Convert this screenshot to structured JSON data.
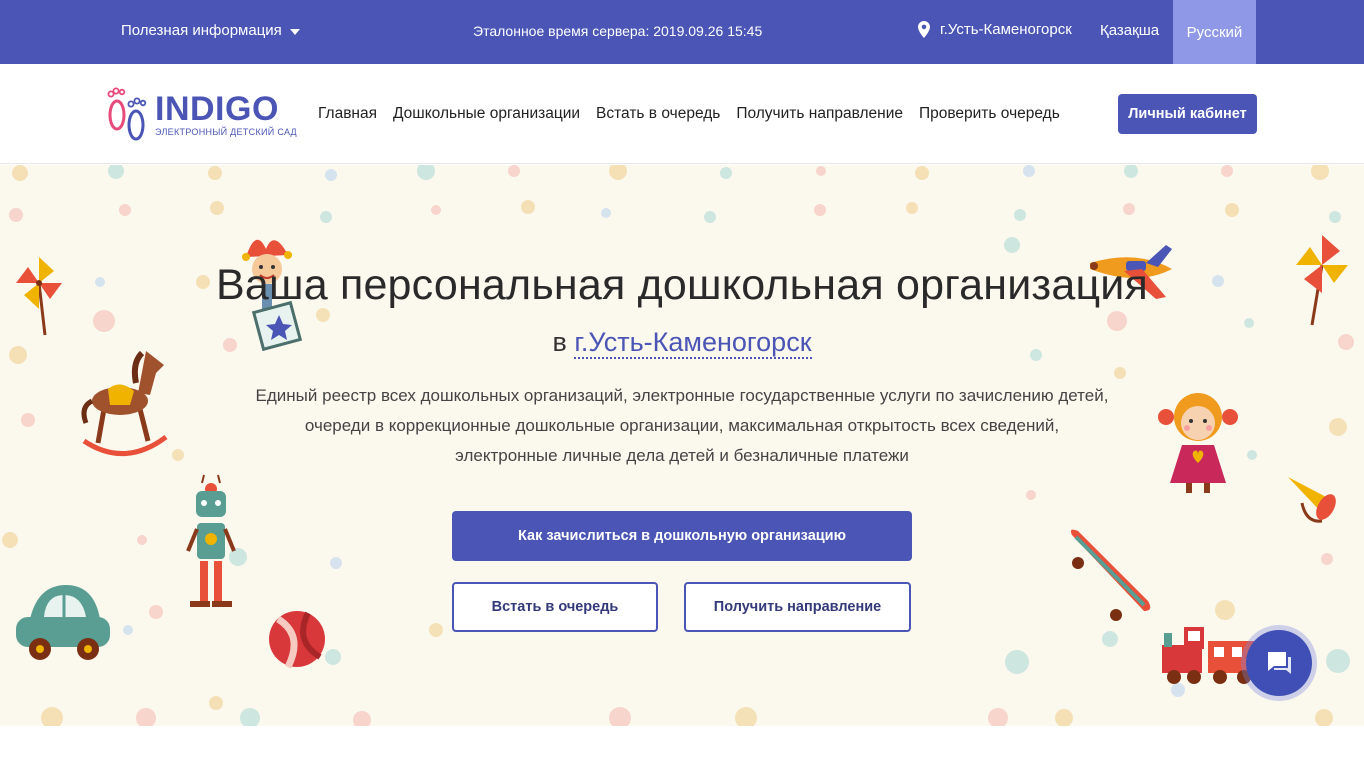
{
  "topbar": {
    "info_label": "Полезная информация",
    "server_time": "Эталонное время сервера: 2019.09.26 15:45",
    "city": "г.Усть-Каменогорск",
    "lang_kz": "Қазақша",
    "lang_ru": "Русский"
  },
  "logo": {
    "name": "INDIGO",
    "subtitle": "ЭЛЕКТРОННЫЙ ДЕТСКИЙ САД"
  },
  "nav": {
    "items": [
      "Главная",
      "Дошкольные организации",
      "Встать в очередь",
      "Получить направление",
      "Проверить очередь"
    ],
    "cabinet": "Личный кабинет"
  },
  "hero": {
    "title": "Ваша персональная дошкольная организация",
    "city_prefix": "в",
    "city_link": "г.Усть-Каменогорск",
    "desc": [
      "Единый реестр всех дошкольных организаций, электронные государственные услуги по зачислению детей,",
      "очереди в коррекционные дошкольные организации, максимальная открытость всех сведений,",
      "электронные личные дела детей и безналичные платежи"
    ],
    "btn_enroll": "Как зачислиться в дошкольную организацию",
    "btn_queue": "Встать в очередь",
    "btn_direction": "Получить направление"
  },
  "colors": {
    "brand": "#4a55b5",
    "brand_light": "#8e98e6",
    "hero_bg": "#fbf8ee"
  },
  "icons": {
    "dropdown": "caret-down-icon",
    "location": "map-pin-icon",
    "chat": "chat-icon"
  }
}
